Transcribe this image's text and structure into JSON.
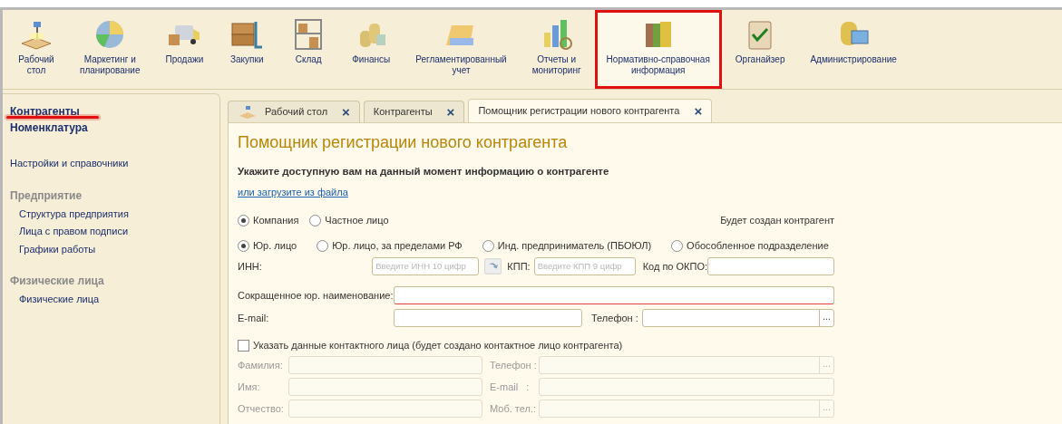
{
  "sections": [
    {
      "label": "Рабочий\nстол",
      "selected": false,
      "highlighted": false
    },
    {
      "label": "Маркетинг и\nпланирование",
      "selected": false,
      "highlighted": false
    },
    {
      "label": "Продажи",
      "selected": false,
      "highlighted": false
    },
    {
      "label": "Закупки",
      "selected": false,
      "highlighted": false
    },
    {
      "label": "Склад",
      "selected": false,
      "highlighted": false
    },
    {
      "label": "Финансы",
      "selected": false,
      "highlighted": false
    },
    {
      "label": "Регламентированный\nучет",
      "selected": false,
      "highlighted": false
    },
    {
      "label": "Отчеты и\nмониторинг",
      "selected": false,
      "highlighted": false
    },
    {
      "label": "Нормативно-справочная\nинформация",
      "selected": true,
      "highlighted": true
    },
    {
      "label": "Органайзер",
      "selected": false,
      "highlighted": false
    },
    {
      "label": "Администрирование",
      "selected": false,
      "highlighted": false
    }
  ],
  "sidebar": {
    "items": [
      {
        "label": "Контрагенты",
        "kind": "primary",
        "underlined": true
      },
      {
        "label": "Номенклатура",
        "kind": "primary",
        "underlined": false
      },
      {
        "label": "Настройки и справочники",
        "kind": "link",
        "underlined": false
      },
      {
        "label": "Предприятие",
        "kind": "group",
        "underlined": false
      },
      {
        "label": "Структура предприятия",
        "kind": "sub",
        "underlined": false
      },
      {
        "label": "Лица с правом подписи",
        "kind": "sub",
        "underlined": false
      },
      {
        "label": "Графики работы",
        "kind": "sub",
        "underlined": false
      },
      {
        "label": "Физические лица",
        "kind": "group",
        "underlined": false
      },
      {
        "label": "Физические лица",
        "kind": "sub",
        "underlined": false
      }
    ]
  },
  "tabs": [
    {
      "label": "Рабочий стол",
      "icon": true,
      "selected": false,
      "close": "×"
    },
    {
      "label": "Контрагенты",
      "icon": false,
      "selected": false,
      "close": "×"
    },
    {
      "label": "Помощник регистрации нового контрагента",
      "icon": false,
      "selected": true,
      "close": "×"
    }
  ],
  "form": {
    "title": "Помощник регистрации нового контрагента",
    "instruction": "Укажите доступную вам на данный момент информацию о контрагенте",
    "load_link": "или загрузите из файла",
    "type_options": [
      {
        "label": "Компания",
        "selected": true
      },
      {
        "label": "Частное лицо",
        "selected": false
      }
    ],
    "result_note": "Будет создан контрагент",
    "legal_forms": [
      {
        "label": "Юр. лицо",
        "selected": true
      },
      {
        "label": "Юр. лицо, за пределами РФ",
        "selected": false
      },
      {
        "label": "Инд. предприниматель (ПБОЮЛ)",
        "selected": false
      },
      {
        "label": "Обособленное подразделение",
        "selected": false
      }
    ],
    "inn": {
      "label": "ИНН:",
      "placeholder": "Введите ИНН 10 цифр"
    },
    "kpp": {
      "label": "КПП:",
      "placeholder": "Введите КПП 9 цифр"
    },
    "okpo": {
      "label": "Код по ОКПО:"
    },
    "short_name": {
      "label": "Сокращенное юр. наименование:",
      "required": true
    },
    "email": {
      "label": "E-mail:"
    },
    "phone": {
      "label": "Телефон :",
      "button": "..."
    },
    "contact_checkbox": {
      "label": "Указать данные контактного лица (будет создано контактное лицо контрагента)",
      "checked": false
    },
    "contact_fields": [
      {
        "label": "Фамилия:",
        "disabled": true
      },
      {
        "label": "Телефон :",
        "disabled": true,
        "button": "..."
      },
      {
        "label": "Имя:",
        "disabled": true
      },
      {
        "label": "E-mail   :",
        "disabled": true
      },
      {
        "label": "Отчество:",
        "disabled": true
      },
      {
        "label": "Моб. тел.:",
        "disabled": true,
        "button": "..."
      }
    ]
  }
}
